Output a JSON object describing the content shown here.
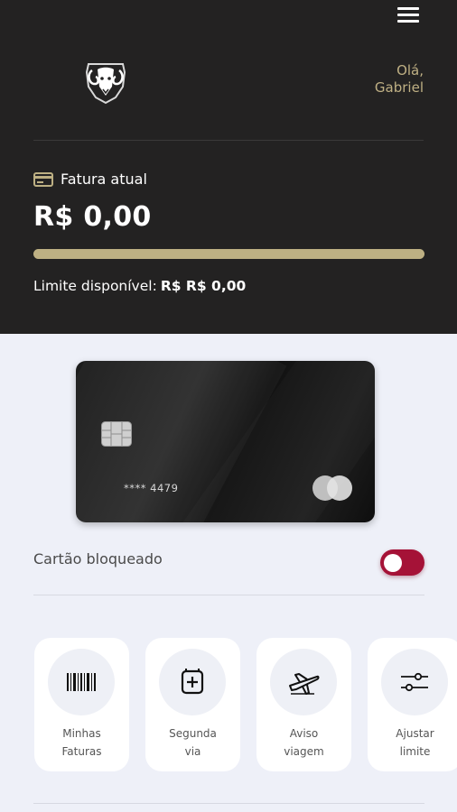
{
  "header": {
    "greeting_line1": "Olá,",
    "greeting_line2": "Gabriel",
    "brand_logo": "ram-head-logo",
    "menu_icon": "hamburger-menu-icon"
  },
  "invoice": {
    "label": "Fatura atual",
    "amount": "R$ 0,00",
    "limit_label": "Limite disponível:",
    "limit_value": "R$ R$ 0,00",
    "progress": 1.0
  },
  "card": {
    "number_masked": "**** 4479",
    "brand": "mastercard-logo"
  },
  "card_block": {
    "label": "Cartão bloqueado",
    "toggle_on": false,
    "toggle_color": "#a51237"
  },
  "actions": [
    {
      "line1": "Minhas",
      "line2": "Faturas",
      "icon": "barcode-icon"
    },
    {
      "line1": "Segunda",
      "line2": "via",
      "icon": "card-add-icon"
    },
    {
      "line1": "Aviso",
      "line2": "viagem",
      "icon": "airplane-icon"
    },
    {
      "line1": "Ajustar",
      "line2": "limite",
      "icon": "sliders-icon"
    }
  ],
  "colors": {
    "header_bg": "#232222",
    "accent_gold": "#bdb083",
    "page_bg": "#eef0f8"
  }
}
